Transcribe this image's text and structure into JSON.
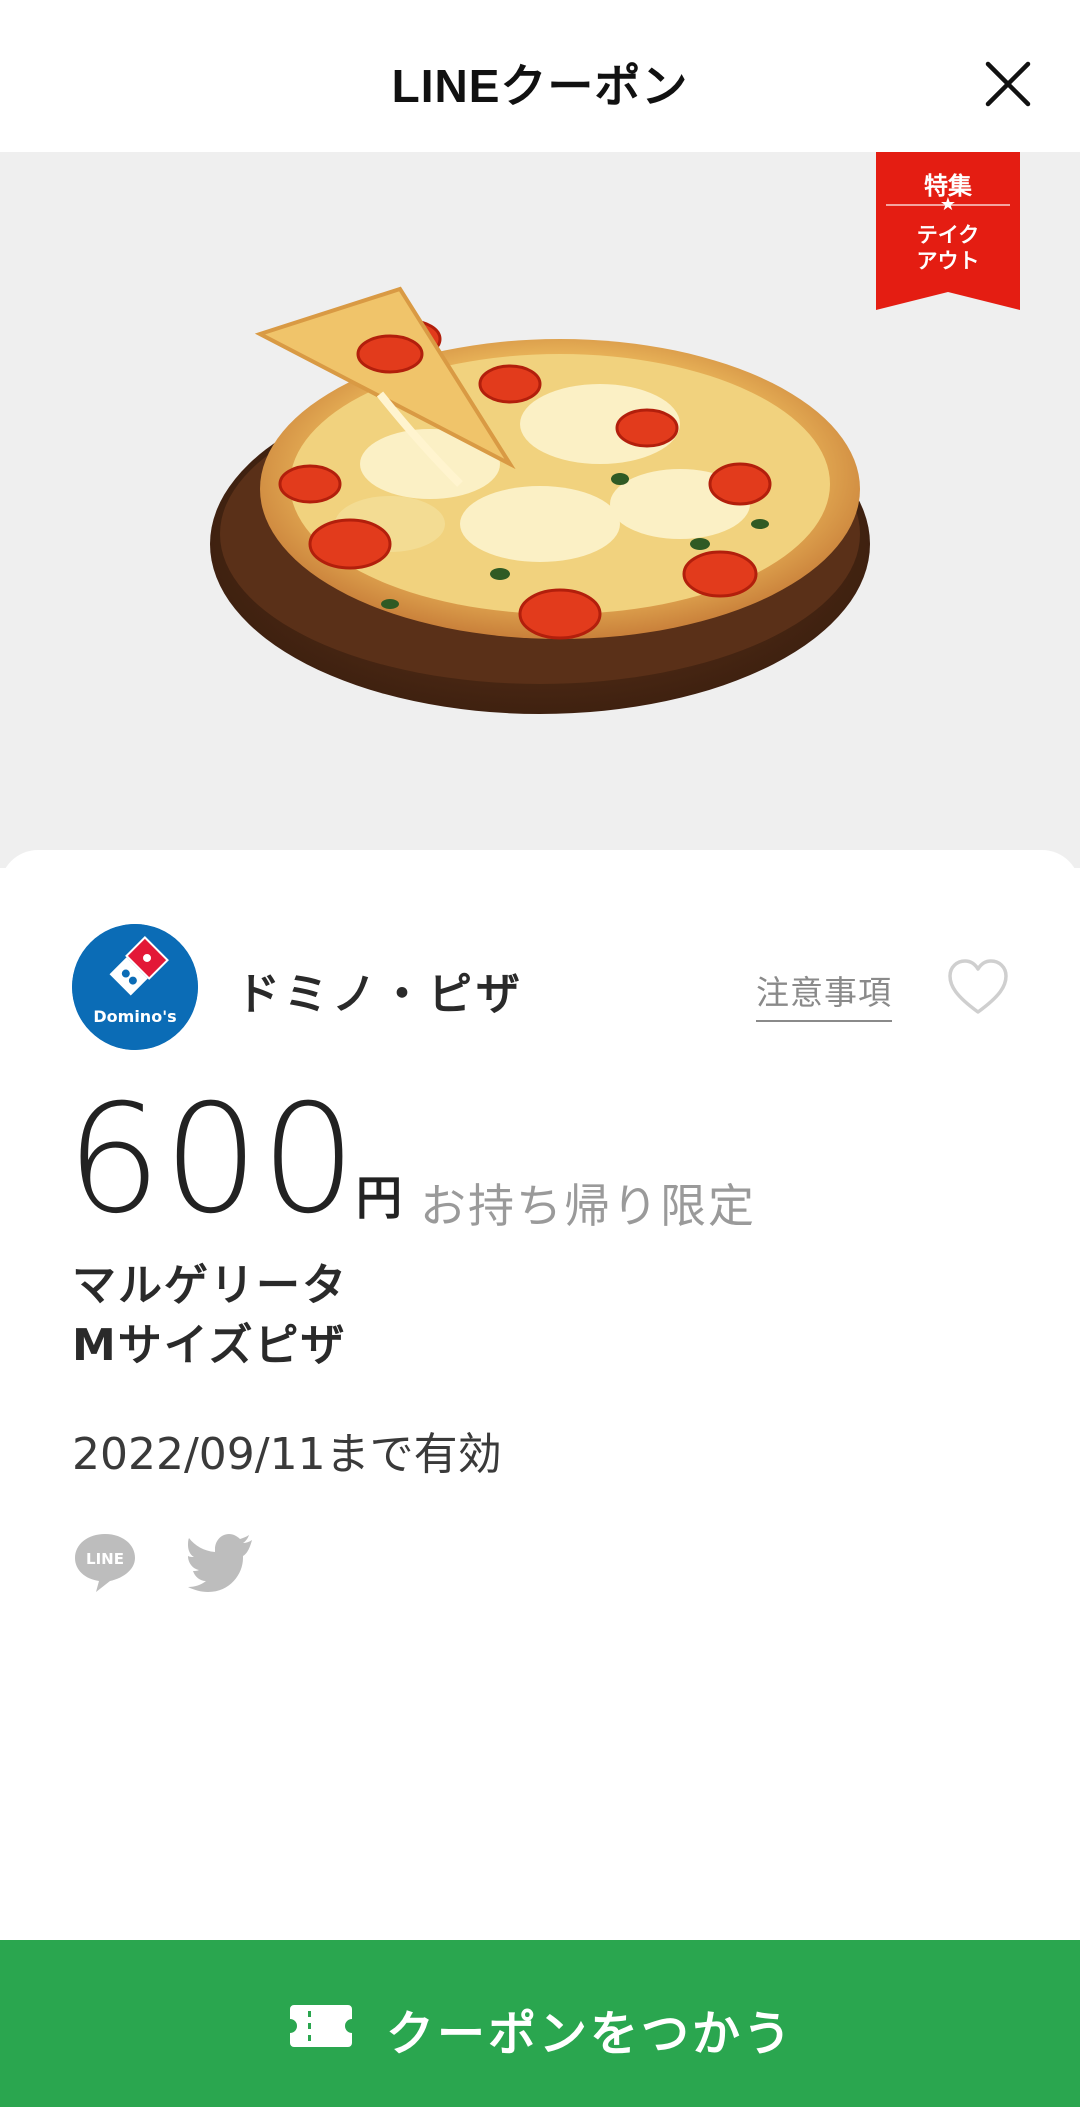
{
  "header": {
    "title": "LINEクーポン"
  },
  "hero": {
    "badge_top": "特集",
    "badge_star": "★",
    "badge_line1": "テイク",
    "badge_line2": "アウト",
    "badge_color": "#e41d12",
    "background": "#efefef"
  },
  "store": {
    "name": "ドミノ・ピザ",
    "logo_text": "Domino's",
    "notes_label": "注意事項"
  },
  "offer": {
    "price": "600",
    "unit": "円",
    "condition": "お持ち帰り限定",
    "item_line1": "マルゲリータ",
    "item_line2": "Mサイズピザ",
    "expiry": "2022/09/11まで有効"
  },
  "share": {
    "line_icon_text": "LINE"
  },
  "footer": {
    "button_label": "クーポンをつかう",
    "button_color": "#2aa64f"
  }
}
